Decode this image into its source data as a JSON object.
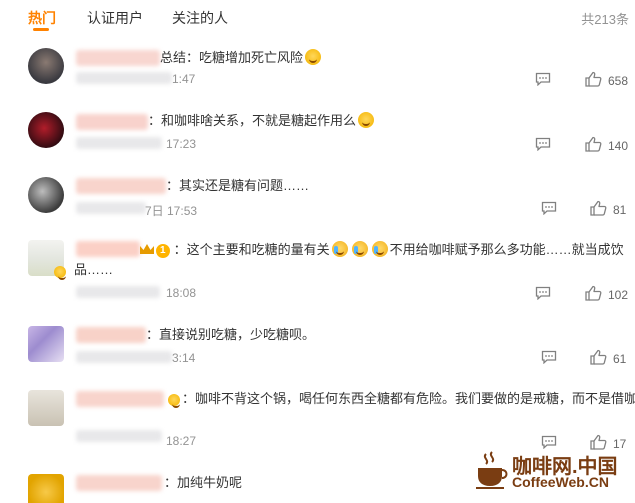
{
  "tabs": [
    {
      "label": "热门",
      "active": true
    },
    {
      "label": "认证用户",
      "active": false
    },
    {
      "label": "关注的人",
      "active": false
    }
  ],
  "total_label": "共213条",
  "comments": [
    {
      "text": "总结：吃糖增加死亡风险",
      "time": "1:47",
      "likes": "658"
    },
    {
      "text": "：和咖啡啥关系，不就是糖起作用么",
      "time": "17:23",
      "likes": "140"
    },
    {
      "text": "：其实还是糖有问题……",
      "time": "7日 17:53",
      "likes": "81"
    },
    {
      "text_a": "：这个主要和吃糖的量有关",
      "text_b": "不用给咖啡赋予那么多功能……就当成饮",
      "text_c": "品……",
      "badge": "1",
      "time": "18:08",
      "likes": "102"
    },
    {
      "text": "：直接说别吃糖，少吃糖呗。",
      "time": "3:14",
      "likes": "61"
    },
    {
      "text": "：咖啡不背这个锅，喝任何东西全糖都有危险。我们要做的是戒糖，而不是借咖啡",
      "time": "18:27",
      "likes": "17"
    },
    {
      "text": "：加纯牛奶呢"
    }
  ],
  "watermark": {
    "title": "咖啡网.中国",
    "subtitle": "CoffeeWeb.CN"
  },
  "colors": {
    "accent": "#ff8200",
    "muted": "#939393",
    "brand": "#7a3d12"
  }
}
